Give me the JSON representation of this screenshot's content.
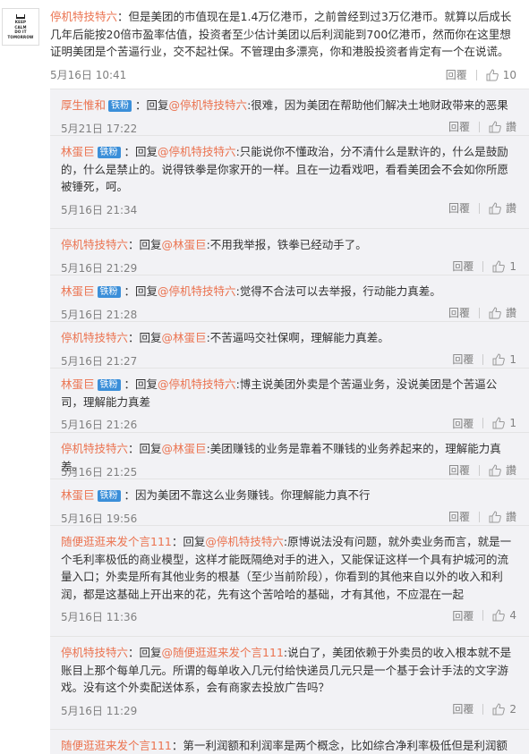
{
  "post": {
    "avatar_lines": [
      "KEEP",
      "CALM",
      "DO IT",
      "TOMORROW"
    ],
    "author": "停机特技特六",
    "text": "：但是美团的市值现在是1.4万亿港币，之前曾经到过3万亿港币。就算以后成长几年后能按20倍市盈率估值，投资者至少估计美团以后利润能到700亿港币，然而你在这里想证明美团是个苦逼行业，交不起社保。不管理由多漂亮，你和港股投资者肯定有一个在说谎。",
    "time": "5月16日 10:41",
    "reply_label": "回覆",
    "like_count": "10"
  },
  "comments": [
    {
      "author": "厚生惟和",
      "badge": "铁粉",
      "reply_prefix": "回复",
      "target": "@停机特技特六",
      "text": ":很难，因为美团在帮助他们解决土地财政带来的恶果",
      "time": "5月21日 17:22",
      "reply_label": "回覆",
      "like_label": "讚"
    },
    {
      "author": "林蛋巨",
      "badge": "铁粉",
      "reply_prefix": "回复",
      "target": "@停机特技特六",
      "text": ":只能说你不懂政治，分不清什么是默许的，什么是鼓励的，什么是禁止的。说得铁拳是你家开的一样。且在一边看戏吧，看看美团会不会如你所愿被锤死，呵。",
      "time": "5月16日 21:34",
      "reply_label": "回覆",
      "like_label": "讚"
    },
    {
      "author": "停机特技特六",
      "badge": "",
      "reply_prefix": "回复",
      "target": "@林蛋巨",
      "text": ":不用我举报，铁拳已经动手了。",
      "time": "5月16日 21:29",
      "reply_label": "回覆",
      "like_label": "1"
    },
    {
      "author": "林蛋巨",
      "badge": "铁粉",
      "reply_prefix": "回复",
      "target": "@停机特技特六",
      "text": ":觉得不合法可以去举报，行动能力真差。",
      "time": "5月16日 21:28",
      "reply_label": "回覆",
      "like_label": "讚"
    },
    {
      "author": "停机特技特六",
      "badge": "",
      "reply_prefix": "回复",
      "target": "@林蛋巨",
      "text": ":不苦逼吗交社保啊，理解能力真差。",
      "time": "5月16日 21:27",
      "reply_label": "回覆",
      "like_label": "1"
    },
    {
      "author": "林蛋巨",
      "badge": "铁粉",
      "reply_prefix": "回复",
      "target": "@停机特技特六",
      "text": ":博主说美团外卖是个苦逼业务，没说美团是个苦逼公司，理解能力真差",
      "time": "5月16日 21:26",
      "reply_label": "回覆",
      "like_label": "1"
    },
    {
      "author": "停机特技特六",
      "badge": "",
      "reply_prefix": "回复",
      "target": "@林蛋巨",
      "text": ":美团赚钱的业务是靠着不赚钱的业务养起来的，理解能力真差。",
      "time": "5月16日 21:25",
      "reply_label": "回覆",
      "like_label": "讚"
    },
    {
      "author": "林蛋巨",
      "badge": "铁粉",
      "reply_prefix": "",
      "target": "",
      "text": "：因为美团不靠这么业务赚钱。你理解能力真不行",
      "time": "5月16日 19:56",
      "reply_label": "回覆",
      "like_label": "讚"
    },
    {
      "author": "随便逛逛来发个言111",
      "badge": "",
      "reply_prefix": "回复",
      "target": "@停机特技特六",
      "text": ":原博说法没有问题，就外卖业务而言，就是一个毛利率极低的商业模型，这样才能既隔绝对手的进入，又能保证这样一个具有护城河的流量入口；外卖是所有其他业务的根基（至少当前阶段），你看到的其他来自以外的收入和利润，都是这基础上开出来的花，先有这个苦哈哈的基础，才有其他，不应混在一起",
      "time": "5月16日 11:36",
      "reply_label": "回覆",
      "like_label": "4"
    },
    {
      "author": "停机特技特六",
      "badge": "",
      "reply_prefix": "回复",
      "target": "@随便逛逛来发个言111",
      "text": ":说白了，美团依赖于外卖员的收入根本就不是账目上那个每单几元。所谓的每单收入几元付给快递员几元只是一个基于会计手法的文字游戏。没有这个外卖配送体系，会有商家去投放广告吗？",
      "time": "5月16日 11:29",
      "reply_label": "回覆",
      "like_label": "2"
    },
    {
      "author": "随便逛逛来发个言111",
      "badge": "",
      "reply_prefix": "",
      "target": "",
      "text": "：第一利润额和利润率是两个概念，比如综合净利率极低但是利润额超",
      "time": "",
      "reply_label": "",
      "like_label": ""
    }
  ]
}
